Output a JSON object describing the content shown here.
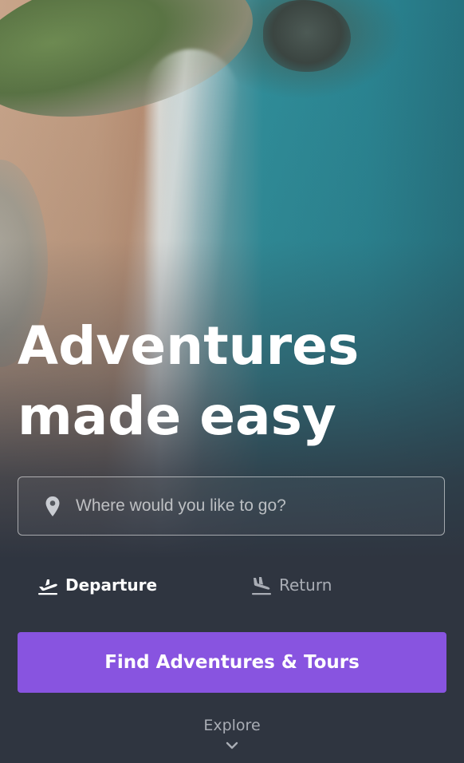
{
  "hero": {
    "headline_line1": "Adventures",
    "headline_line2": "made easy"
  },
  "search": {
    "placeholder": "Where would you like to go?",
    "value": "",
    "icon": "map-pin-icon"
  },
  "dates": {
    "departure_label": "Departure",
    "departure_icon": "plane-departure-icon",
    "return_label": "Return",
    "return_icon": "plane-arrival-icon"
  },
  "cta": {
    "label": "Find Adventures & Tours"
  },
  "explore": {
    "label": "Explore",
    "icon": "chevron-down-icon"
  },
  "colors": {
    "accent": "#8854e0",
    "background": "#2f3540",
    "muted_text": "#a9adb5",
    "text": "#ffffff"
  }
}
